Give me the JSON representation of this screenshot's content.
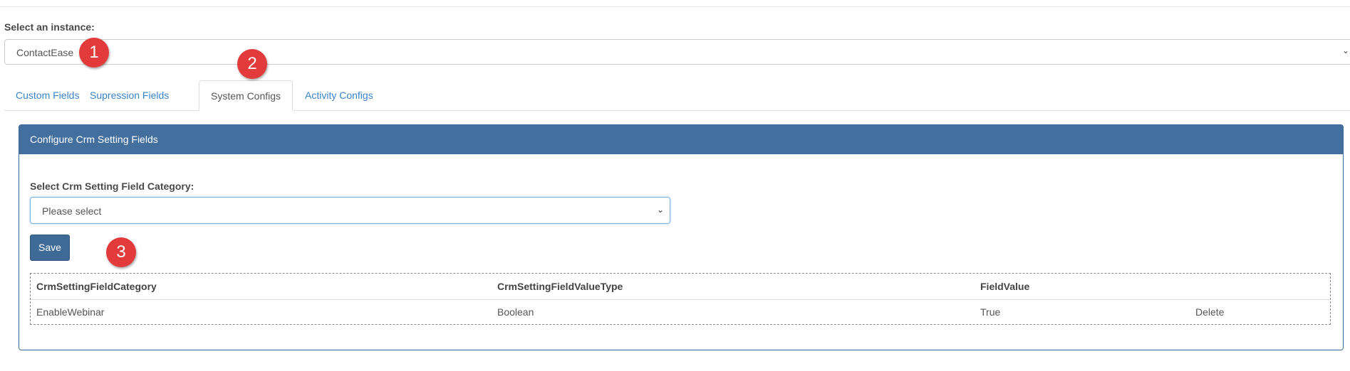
{
  "instance": {
    "label": "Select an instance:",
    "selected": "ContactEase"
  },
  "tabs": [
    {
      "label": "Custom Fields",
      "active": false
    },
    {
      "label": "Supression Fields",
      "active": false
    },
    {
      "label": "System Configs",
      "active": true
    },
    {
      "label": "Activity Configs",
      "active": false
    }
  ],
  "panel": {
    "title": "Configure Crm Setting Fields",
    "category_label": "Select Crm Setting Field Category:",
    "category_selected": "Please select",
    "save_label": "Save"
  },
  "table": {
    "headers": [
      "CrmSettingFieldCategory",
      "CrmSettingFieldValueType",
      "FieldValue"
    ],
    "rows": [
      {
        "category": "EnableWebinar",
        "value_type": "Boolean",
        "field_value": "True",
        "action": "Delete"
      }
    ]
  },
  "markers": [
    "1",
    "2",
    "3"
  ],
  "colors": {
    "panel_header": "#426f9d",
    "link": "#3a84c9",
    "marker": "#e33b3b"
  },
  "icons": {
    "dropdown": "chevron-down-icon"
  }
}
